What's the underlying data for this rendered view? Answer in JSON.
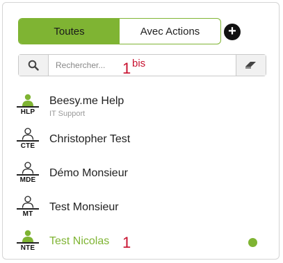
{
  "tabs": {
    "all": "Toutes",
    "with_actions": "Avec Actions"
  },
  "add_icon": "plus-circle-icon",
  "search": {
    "placeholder": "Rechercher...",
    "value": "",
    "icon": "search-icon",
    "clear_icon": "eraser-icon"
  },
  "annotations": {
    "search_main": "1",
    "search_sup": "bis",
    "contact": "1"
  },
  "colors": {
    "accent": "#7fb433",
    "annotation": "#c8102e",
    "online": "#7fb433"
  },
  "contacts": [
    {
      "initials": "HLP",
      "name": "Beesy.me Help",
      "subtitle": "IT Support",
      "avatar_color": "#7fb433"
    },
    {
      "initials": "CTE",
      "name": "Christopher Test",
      "avatar_color": "#222222"
    },
    {
      "initials": "MDE",
      "name": "Démo Monsieur",
      "avatar_color": "#222222"
    },
    {
      "initials": "MT",
      "name": "Test Monsieur",
      "avatar_color": "#222222"
    },
    {
      "initials": "NTE",
      "name": "Test Nicolas",
      "avatar_color": "#7fb433",
      "name_color": "#7fb433",
      "status": "online"
    }
  ]
}
